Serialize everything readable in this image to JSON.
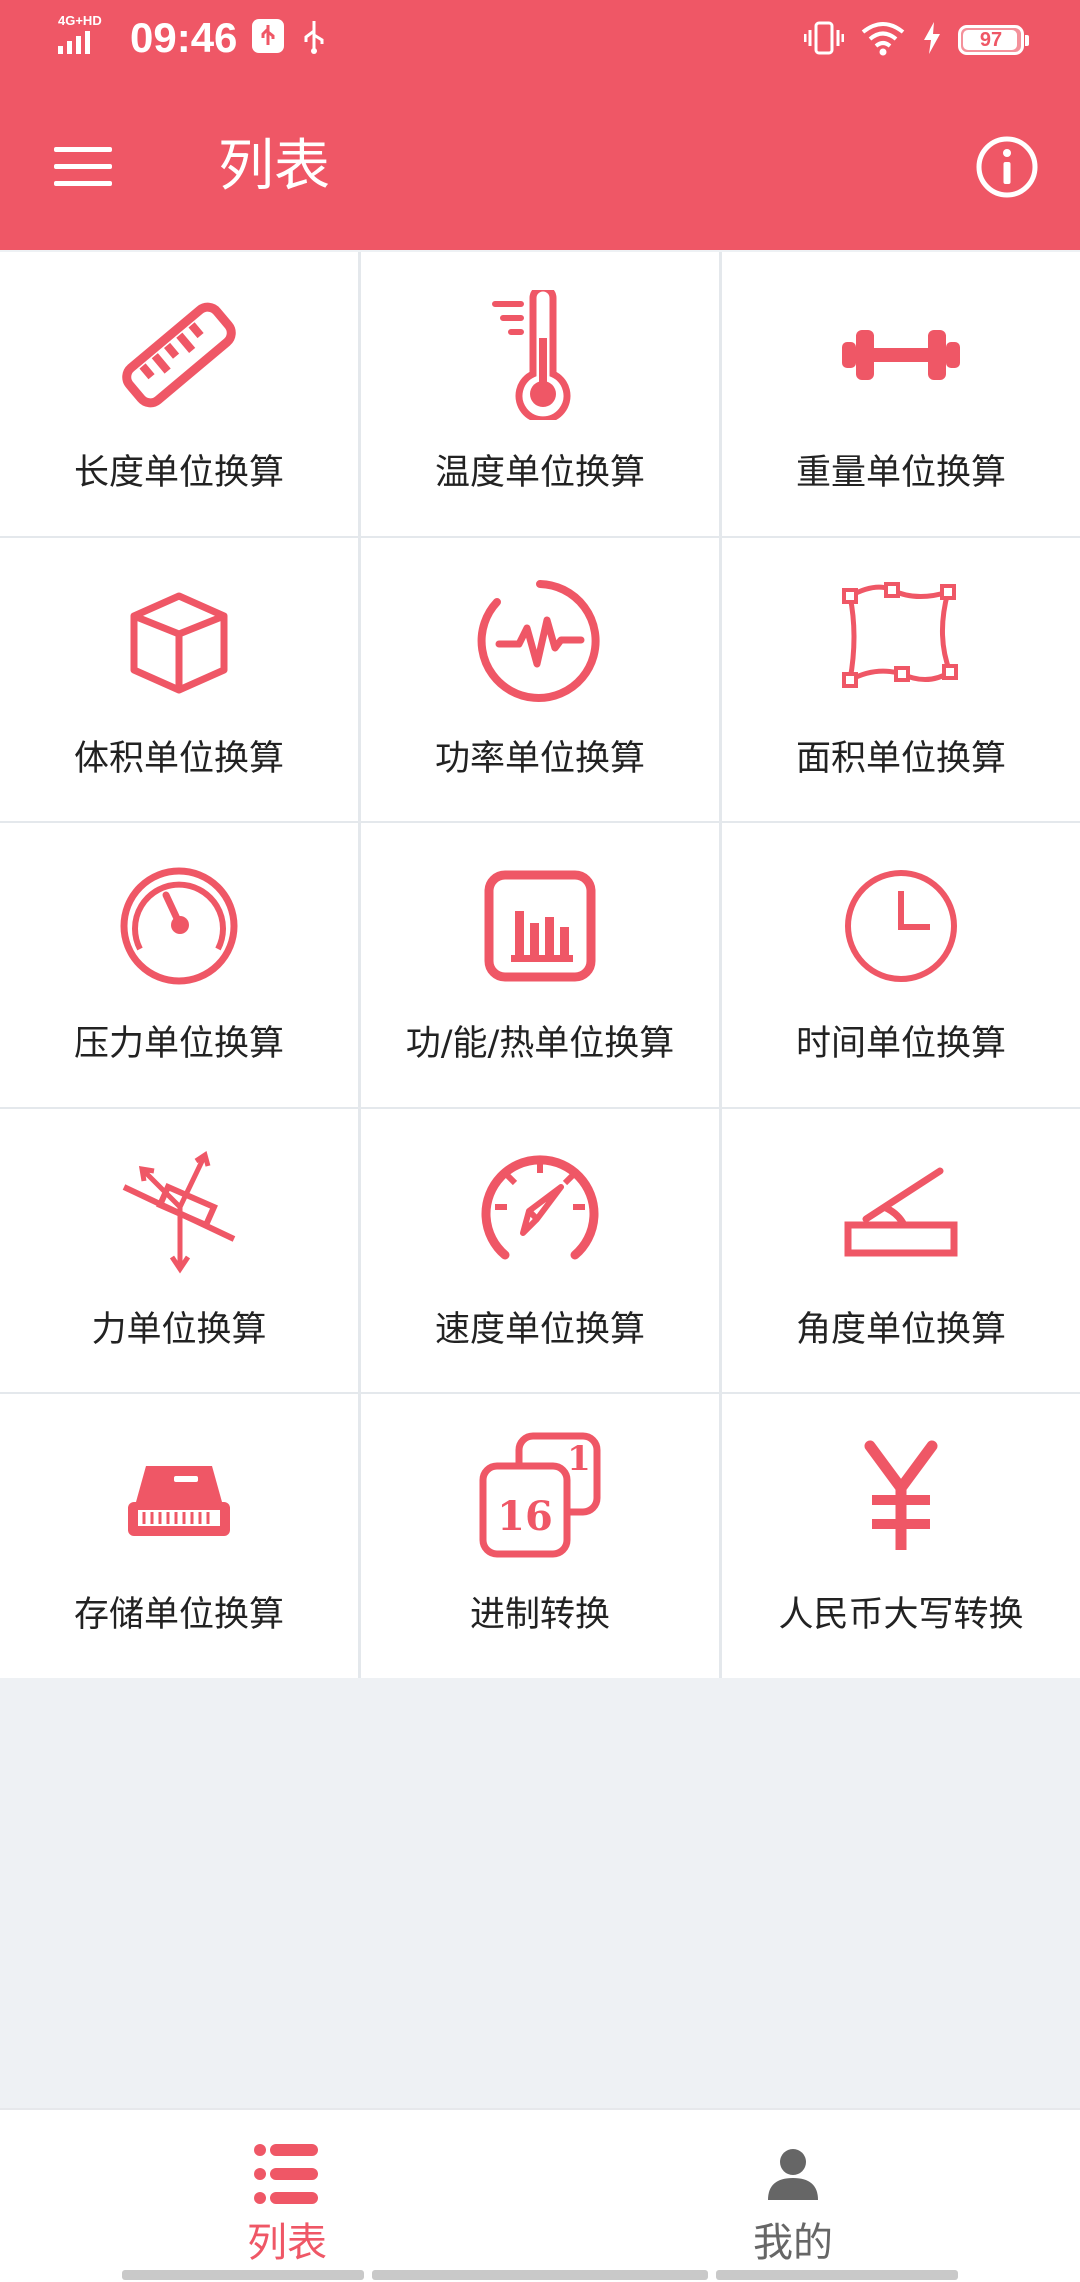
{
  "status_bar": {
    "network": "4G+HD",
    "time": "09:46",
    "battery": "97",
    "battery_level": 0.97
  },
  "toolbar": {
    "title": "列表",
    "menu_icon": "menu-icon",
    "info_icon": "info-icon"
  },
  "colors": {
    "accent": "#ef5766",
    "background": "#eef1f4"
  },
  "grid": {
    "items": [
      {
        "label": "长度单位换算",
        "icon": "ruler-icon"
      },
      {
        "label": "温度单位换算",
        "icon": "thermometer-icon"
      },
      {
        "label": "重量单位换算",
        "icon": "dumbbell-icon"
      },
      {
        "label": "体积单位换算",
        "icon": "cube-icon"
      },
      {
        "label": "功率单位换算",
        "icon": "power-pulse-icon"
      },
      {
        "label": "面积单位换算",
        "icon": "area-polygon-icon"
      },
      {
        "label": "压力单位换算",
        "icon": "pressure-gauge-icon"
      },
      {
        "label": "功/能/热单位换算",
        "icon": "bar-chart-icon"
      },
      {
        "label": "时间单位换算",
        "icon": "clock-icon"
      },
      {
        "label": "力单位换算",
        "icon": "force-vector-icon"
      },
      {
        "label": "速度单位换算",
        "icon": "speedometer-icon"
      },
      {
        "label": "角度单位换算",
        "icon": "angle-icon"
      },
      {
        "label": "存储单位换算",
        "icon": "storage-drive-icon"
      },
      {
        "label": "进制转换",
        "icon": "number-base-icon"
      },
      {
        "label": "人民币大写转换",
        "icon": "yuan-icon"
      }
    ]
  },
  "bottom_nav": {
    "tabs": [
      {
        "label": "列表",
        "icon": "list-icon",
        "active": true
      },
      {
        "label": "我的",
        "icon": "person-icon",
        "active": false
      }
    ]
  },
  "number_base_icon_text": {
    "big": "16",
    "small": "1"
  }
}
